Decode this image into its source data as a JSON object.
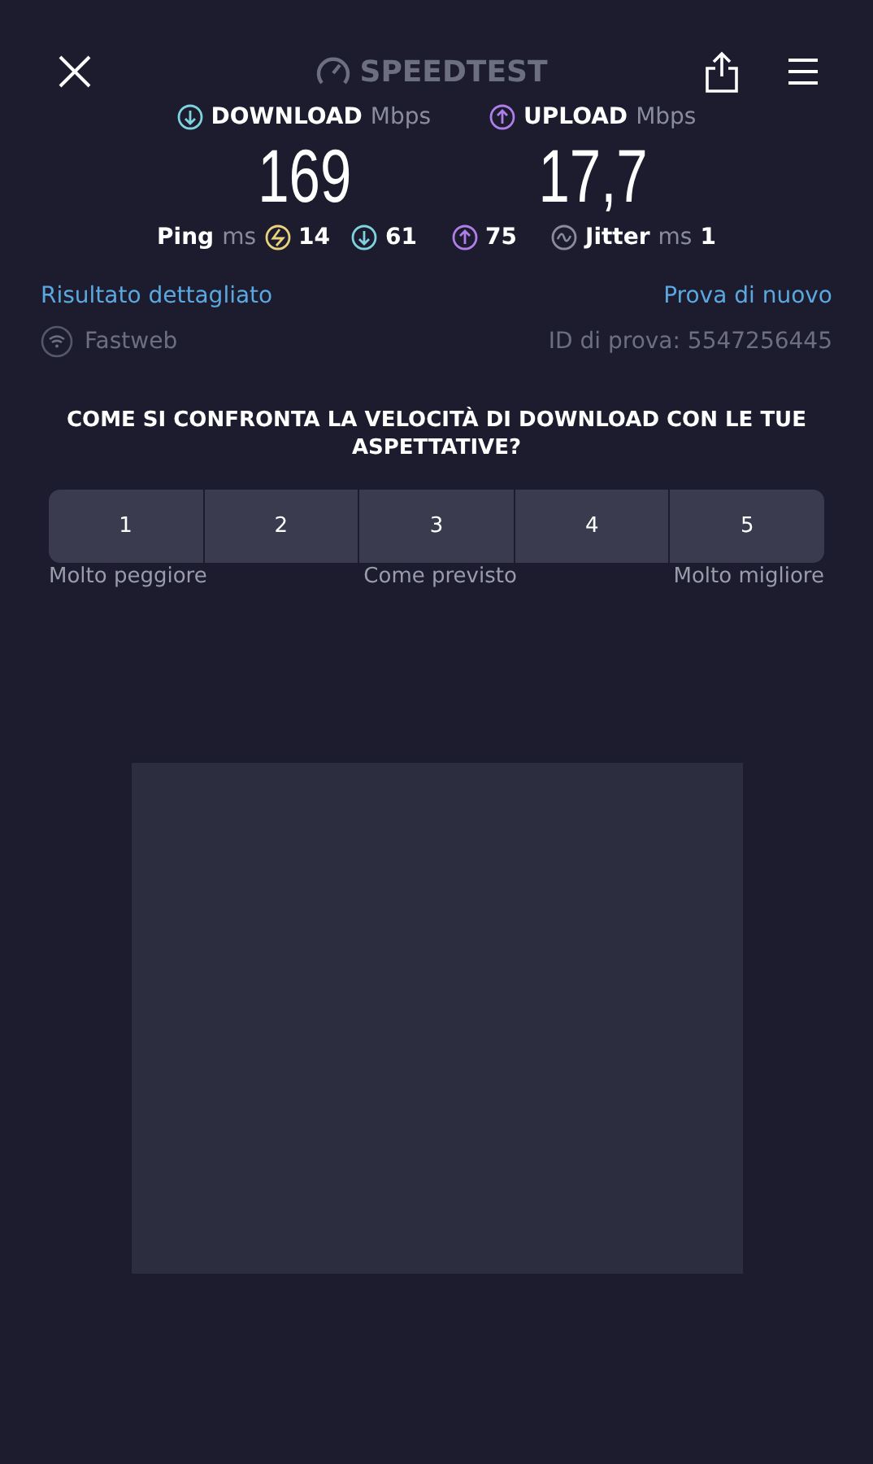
{
  "header": {
    "title": "SPEEDTEST"
  },
  "results": [
    {
      "kind": "download",
      "label": "DOWNLOAD",
      "unit": "Mbps",
      "value": "169"
    },
    {
      "kind": "upload",
      "label": "UPLOAD",
      "unit": "Mbps",
      "value": "17,7"
    }
  ],
  "ping": {
    "label": "Ping",
    "unit": "ms",
    "idle": "14",
    "download": "61",
    "upload": "75"
  },
  "jitter": {
    "label": "Jitter",
    "unit": "ms",
    "value": "1"
  },
  "links": {
    "detail": "Risultato dettagliato",
    "retry": "Prova di nuovo"
  },
  "provider": "Fastweb",
  "test_id": "ID di prova: 5547256445",
  "survey": {
    "question": "COME SI CONFRONTA LA VELOCITÀ DI DOWNLOAD CON LE TUE ASPETTATIVE?",
    "options": [
      {
        "label": "1",
        "selected": false
      },
      {
        "label": "2",
        "selected": false
      },
      {
        "label": "3",
        "selected": false
      },
      {
        "label": "4",
        "selected": false
      },
      {
        "label": "5",
        "selected": false
      }
    ],
    "scale": [
      "Molto peggiore",
      "Come previsto",
      "Molto migliore"
    ]
  }
}
